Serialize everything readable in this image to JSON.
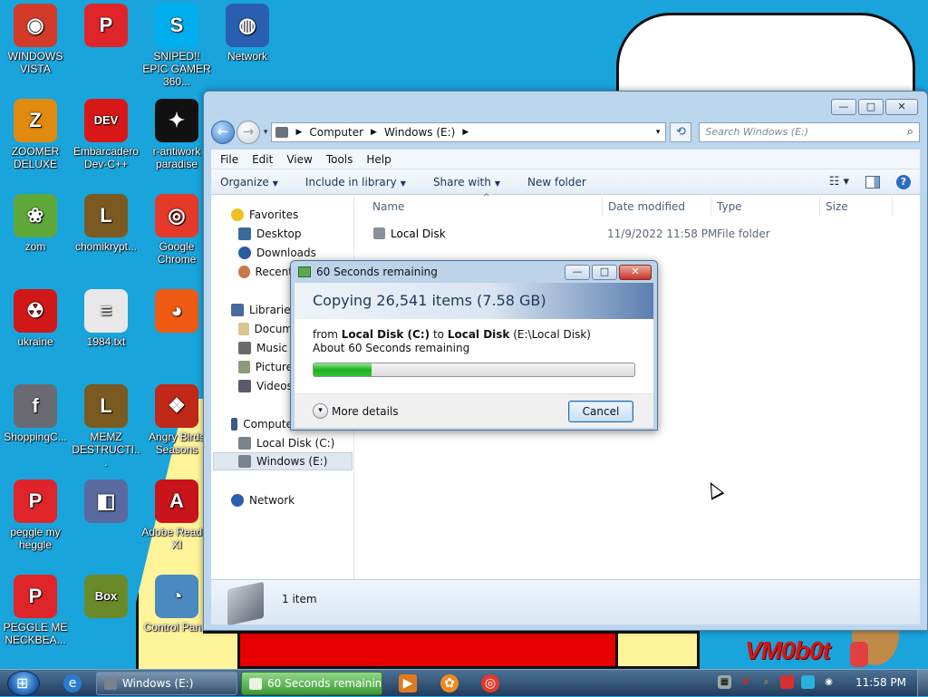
{
  "desktop": {
    "bubble_text": "",
    "watermark": "VM0b0t",
    "icons": [
      {
        "id": "windows-vista",
        "label": "WINDOWS VISTA",
        "color": "#d23a2a",
        "glyph": "◉"
      },
      {
        "id": "peggle-1",
        "label": "",
        "color": "#e0252a",
        "glyph": "P"
      },
      {
        "id": "sniped",
        "label": "SNIPED!! EPIC GAMER 360...",
        "color": "#00aff0",
        "glyph": "S"
      },
      {
        "id": "network",
        "label": "Network",
        "color": "#2a5fb0",
        "glyph": "◍"
      },
      {
        "id": "zoomer",
        "label": "ZOOMER DELUXE",
        "color": "#e08a10",
        "glyph": "Z"
      },
      {
        "id": "devcpp",
        "label": "Embarcadero Dev-C++",
        "color": "#d81818",
        "glyph": "DEV"
      },
      {
        "id": "antiwork",
        "label": "r-antiwork paradise",
        "color": "#111111",
        "glyph": "✦"
      },
      {
        "id": "zom",
        "label": "zom",
        "color": "#5fa83a",
        "glyph": "❀"
      },
      {
        "id": "chomikrypt",
        "label": "chomikrypt...",
        "color": "#7a5a20",
        "glyph": "L"
      },
      {
        "id": "chrome",
        "label": "Google Chrome",
        "color": "#e53a2a",
        "glyph": "◎"
      },
      {
        "id": "ukraine",
        "label": "ukraine",
        "color": "#d01818",
        "glyph": "☢"
      },
      {
        "id": "1984",
        "label": "1984.txt",
        "color": "#e8e8e8",
        "glyph": "≡"
      },
      {
        "id": "furryfuck",
        "label": "",
        "color": "#f05a12",
        "glyph": "◕"
      },
      {
        "id": "shoppingc",
        "label": "ShoppingC...",
        "color": "#6a6a72",
        "glyph": "f"
      },
      {
        "id": "memz",
        "label": "MEMZ DESTRUCTI...",
        "color": "#7a5a20",
        "glyph": "L"
      },
      {
        "id": "angrybirds",
        "label": "Angry Birds Seasons",
        "color": "#c02818",
        "glyph": "❖"
      },
      {
        "id": "peggle-2",
        "label": "peggle my heggle",
        "color": "#e0252a",
        "glyph": "P"
      },
      {
        "id": "gaymes",
        "label": "",
        "color": "#5a6aa0",
        "glyph": "◧"
      },
      {
        "id": "adobe",
        "label": "Adobe Reader XI",
        "color": "#c8141a",
        "glyph": "A"
      },
      {
        "id": "peggle-3",
        "label": "PEGGLE ME NECKBEA...",
        "color": "#e0252a",
        "glyph": "P"
      },
      {
        "id": "box",
        "label": "",
        "color": "#6a8a2a",
        "glyph": "Box"
      },
      {
        "id": "control-panel",
        "label": "Control Panel",
        "color": "#4a8ac0",
        "glyph": "◔"
      }
    ]
  },
  "explorer": {
    "title_controls": {
      "minimize": "—",
      "maximize": "□",
      "close": "✕"
    },
    "back_glyph": "←",
    "forward_glyph": "→",
    "dropdown_glyph": "▾",
    "breadcrumb": [
      "Computer",
      "Windows (E:)"
    ],
    "refresh_glyph": "⟲",
    "search_placeholder": "Search Windows (E:)",
    "menu": [
      "File",
      "Edit",
      "View",
      "Tools",
      "Help"
    ],
    "toolbar": {
      "organize": "Organize",
      "include_in_library": "Include in library",
      "share_with": "Share with",
      "new_folder": "New folder",
      "help_glyph": "?"
    },
    "nav": {
      "favorites": "Favorites",
      "desktop": "Desktop",
      "downloads": "Downloads",
      "recent": "Recent",
      "libraries": "Libraries",
      "documents": "Docum",
      "music": "Music",
      "pictures": "Picture",
      "videos": "Videos",
      "computer": "Compute",
      "local_disk": "Local Disk (C:)",
      "windows_e": "Windows (E:)",
      "network": "Network"
    },
    "columns": {
      "name": "Name",
      "date_modified": "Date modified",
      "type": "Type",
      "size": "Size"
    },
    "files": [
      {
        "name": "Local Disk",
        "date_modified": "11/9/2022 11:58 PM",
        "type": "File folder",
        "size": ""
      }
    ],
    "status": "1 item"
  },
  "copy_dialog": {
    "title": "60 Seconds remaining",
    "heading": "Copying 26,541 items (7.58 GB)",
    "from_prefix": "from",
    "from_source": "Local Disk (C:)",
    "to_word": "to",
    "to_dest": "Local Disk",
    "to_path": "(E:\\Local Disk)",
    "time_remaining": "About 60 Seconds remaining",
    "progress_fraction": 0.18,
    "more_details": "More details",
    "cancel": "Cancel"
  },
  "taskbar": {
    "tasks": [
      {
        "label": "Windows (E:)",
        "active": false
      },
      {
        "label": "60 Seconds remaining",
        "active": true
      }
    ],
    "clock": "11:58 PM"
  }
}
